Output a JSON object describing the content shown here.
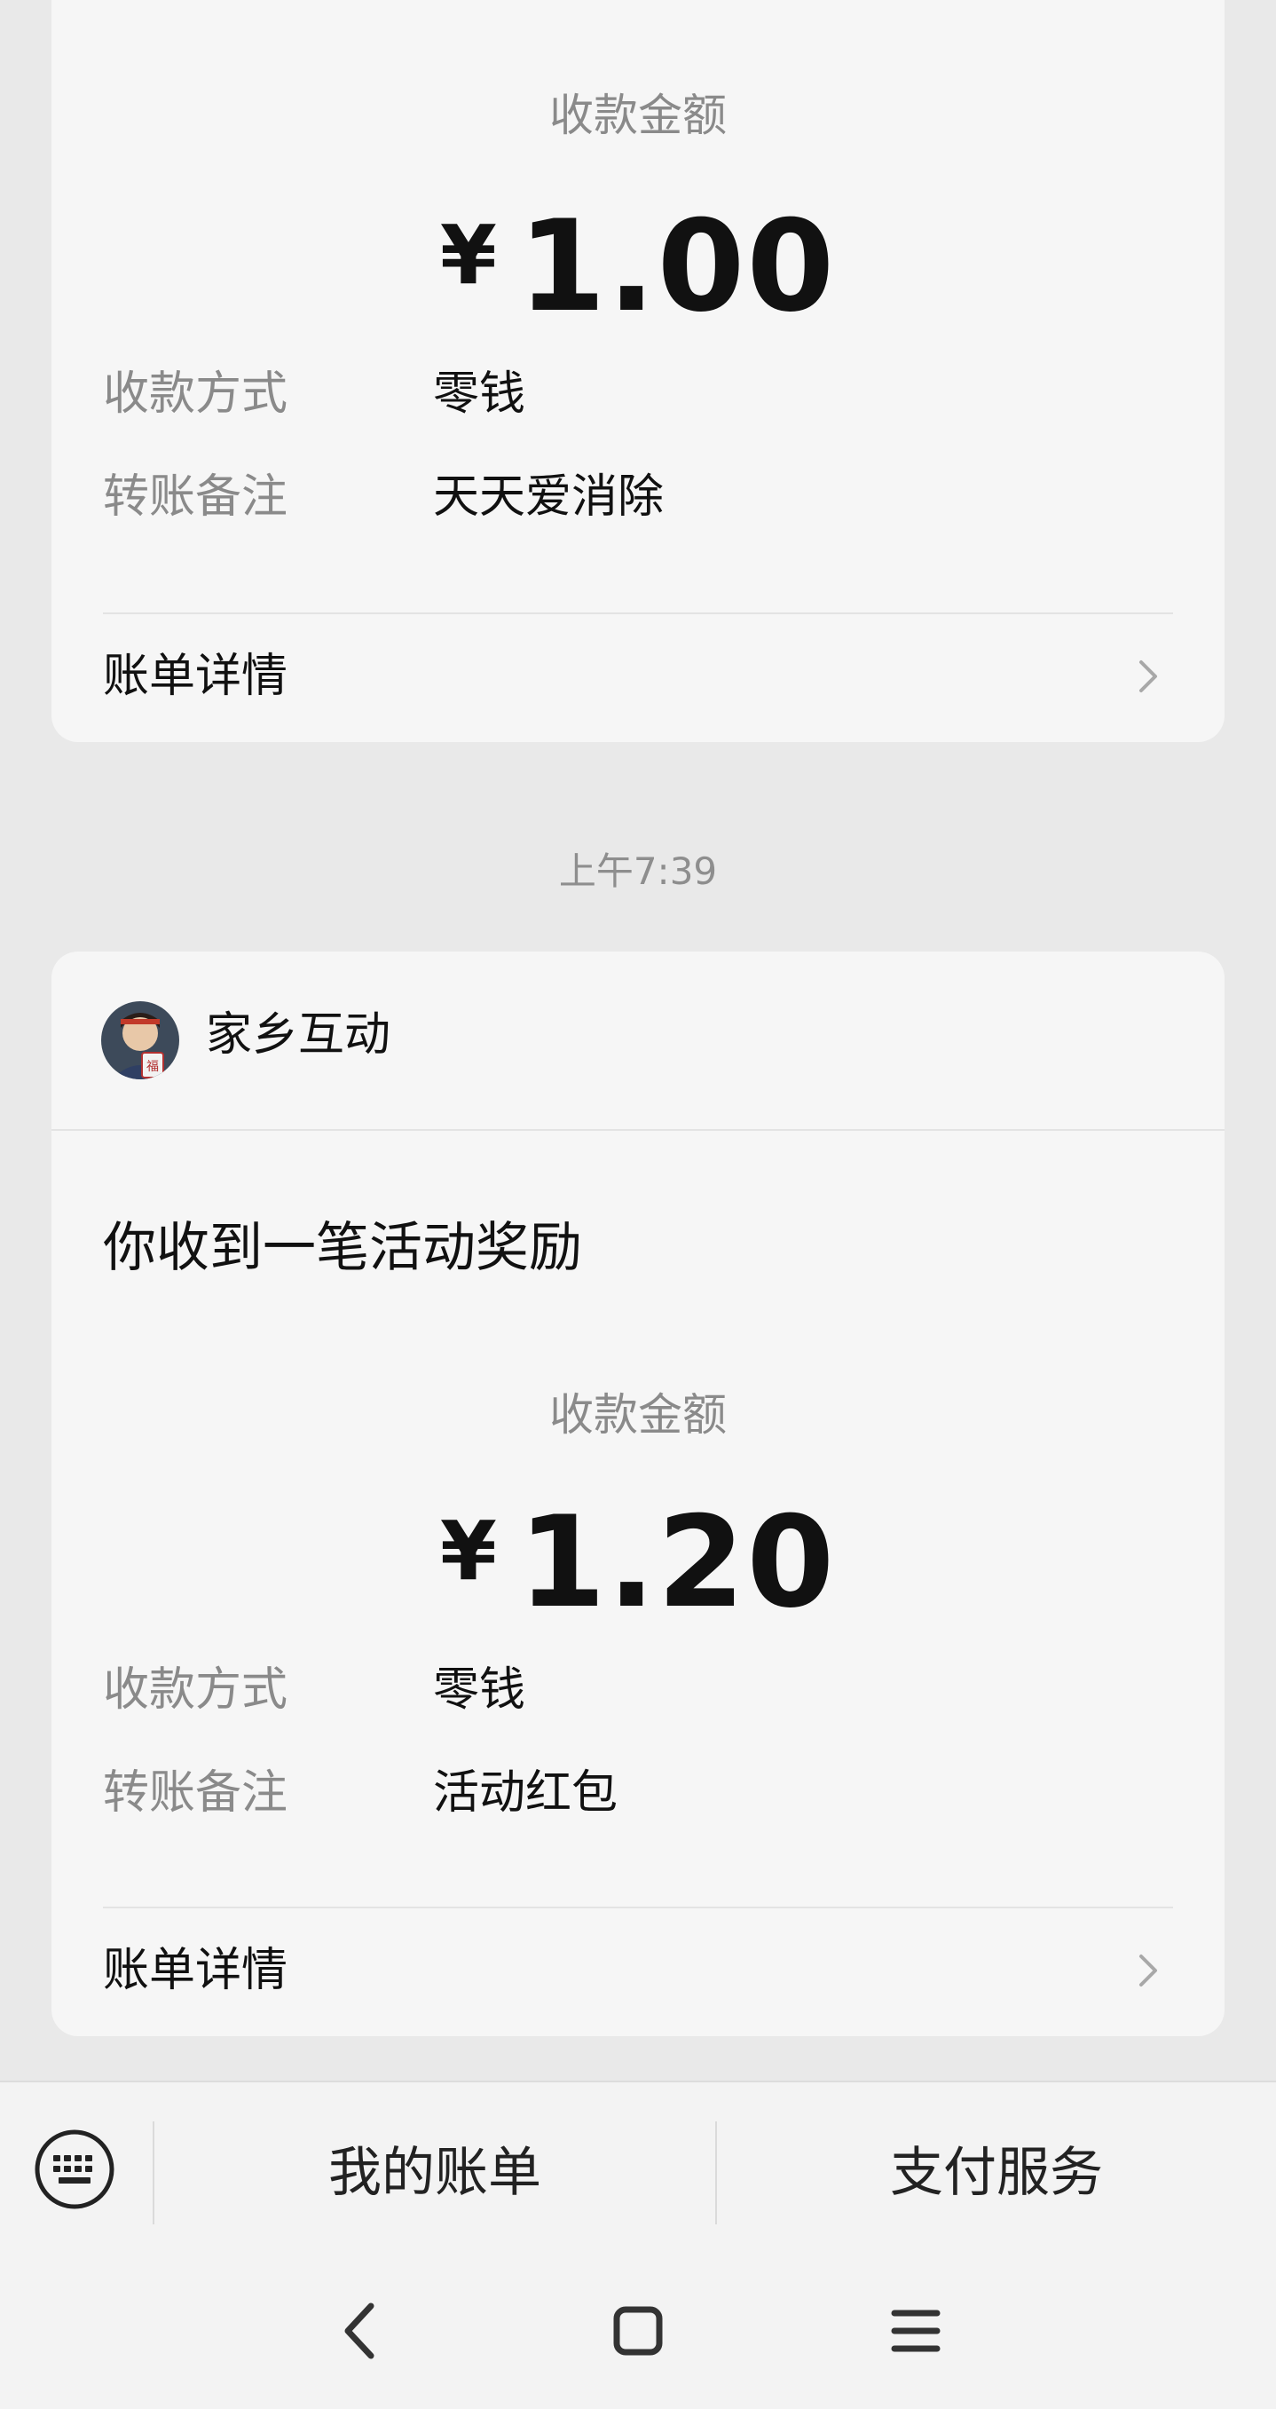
{
  "card1": {
    "amount_label": "收款金额",
    "currency": "¥",
    "amount": "1.00",
    "method_key": "收款方式",
    "method_value": "零钱",
    "note_key": "转账备注",
    "note_value": "天天爱消除",
    "detail_label": "账单详情"
  },
  "timestamp": "上午7:39",
  "card2": {
    "sender_name": "家乡互动",
    "headline": "你收到一笔活动奖励",
    "amount_label": "收款金额",
    "currency": "¥",
    "amount": "1.20",
    "method_key": "收款方式",
    "method_value": "零钱",
    "note_key": "转账备注",
    "note_value": "活动红包",
    "detail_label": "账单详情"
  },
  "bottom_menu": {
    "my_bills": "我的账单",
    "payment_services": "支付服务"
  },
  "icons": {
    "keyboard": "keyboard-icon",
    "chevron": "chevron-right-icon",
    "back": "back-icon",
    "home": "home-icon",
    "recents": "menu-icon"
  }
}
